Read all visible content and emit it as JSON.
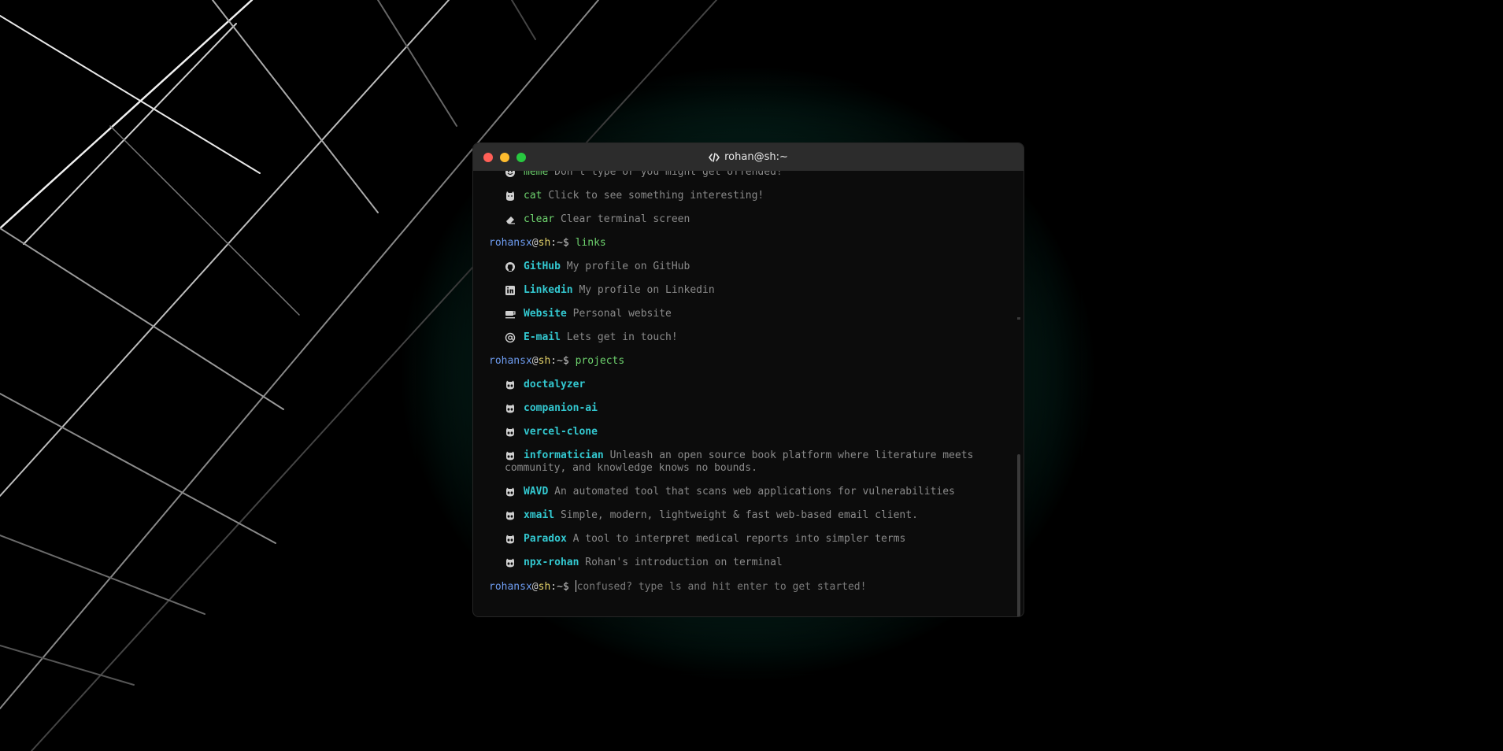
{
  "window": {
    "title": "rohan@sh:~"
  },
  "prompt": {
    "user": "rohansx",
    "at": "@",
    "host": "sh",
    "path": ":~$"
  },
  "help_tail": [
    {
      "icon": "smile-icon",
      "cmd": "meme",
      "desc": "Don't type or you might get offended!"
    },
    {
      "icon": "cat-icon",
      "cmd": "cat",
      "desc": "Click to see something interesting!"
    },
    {
      "icon": "eraser-icon",
      "cmd": "clear",
      "desc": "Clear terminal screen"
    }
  ],
  "links_command": "links",
  "links": [
    {
      "icon": "github-icon",
      "name": "GitHub",
      "desc": "My profile on GitHub"
    },
    {
      "icon": "linkedin-icon",
      "name": "Linkedin",
      "desc": "My profile on Linkedin"
    },
    {
      "icon": "coffee-icon",
      "name": "Website",
      "desc": "Personal website"
    },
    {
      "icon": "at-icon",
      "name": "E-mail",
      "desc": "Lets get in touch!"
    }
  ],
  "projects_command": "projects",
  "projects": [
    {
      "name": "doctalyzer",
      "desc": ""
    },
    {
      "name": "companion-ai",
      "desc": ""
    },
    {
      "name": "vercel-clone",
      "desc": ""
    },
    {
      "name": "informatician",
      "desc": "Unleash an open source book platform where literature meets community, and knowledge knows no bounds."
    },
    {
      "name": "WAVD",
      "desc": "An automated tool that scans web applications for vulnerabilities"
    },
    {
      "name": "xmail",
      "desc": "Simple, modern, lightweight & fast web-based email client."
    },
    {
      "name": "Paradox",
      "desc": "A tool to interpret medical reports into simpler terms"
    },
    {
      "name": "npx-rohan",
      "desc": "Rohan's introduction on terminal"
    }
  ],
  "input": {
    "placeholder": "confused? type ls and hit enter to get started!"
  },
  "colors": {
    "accent_green": "#6ed36e",
    "accent_cyan": "#33c8d0",
    "prompt_blue": "#6e9cf0",
    "prompt_yellow": "#e6d46a",
    "glow": "#0e6f58"
  }
}
